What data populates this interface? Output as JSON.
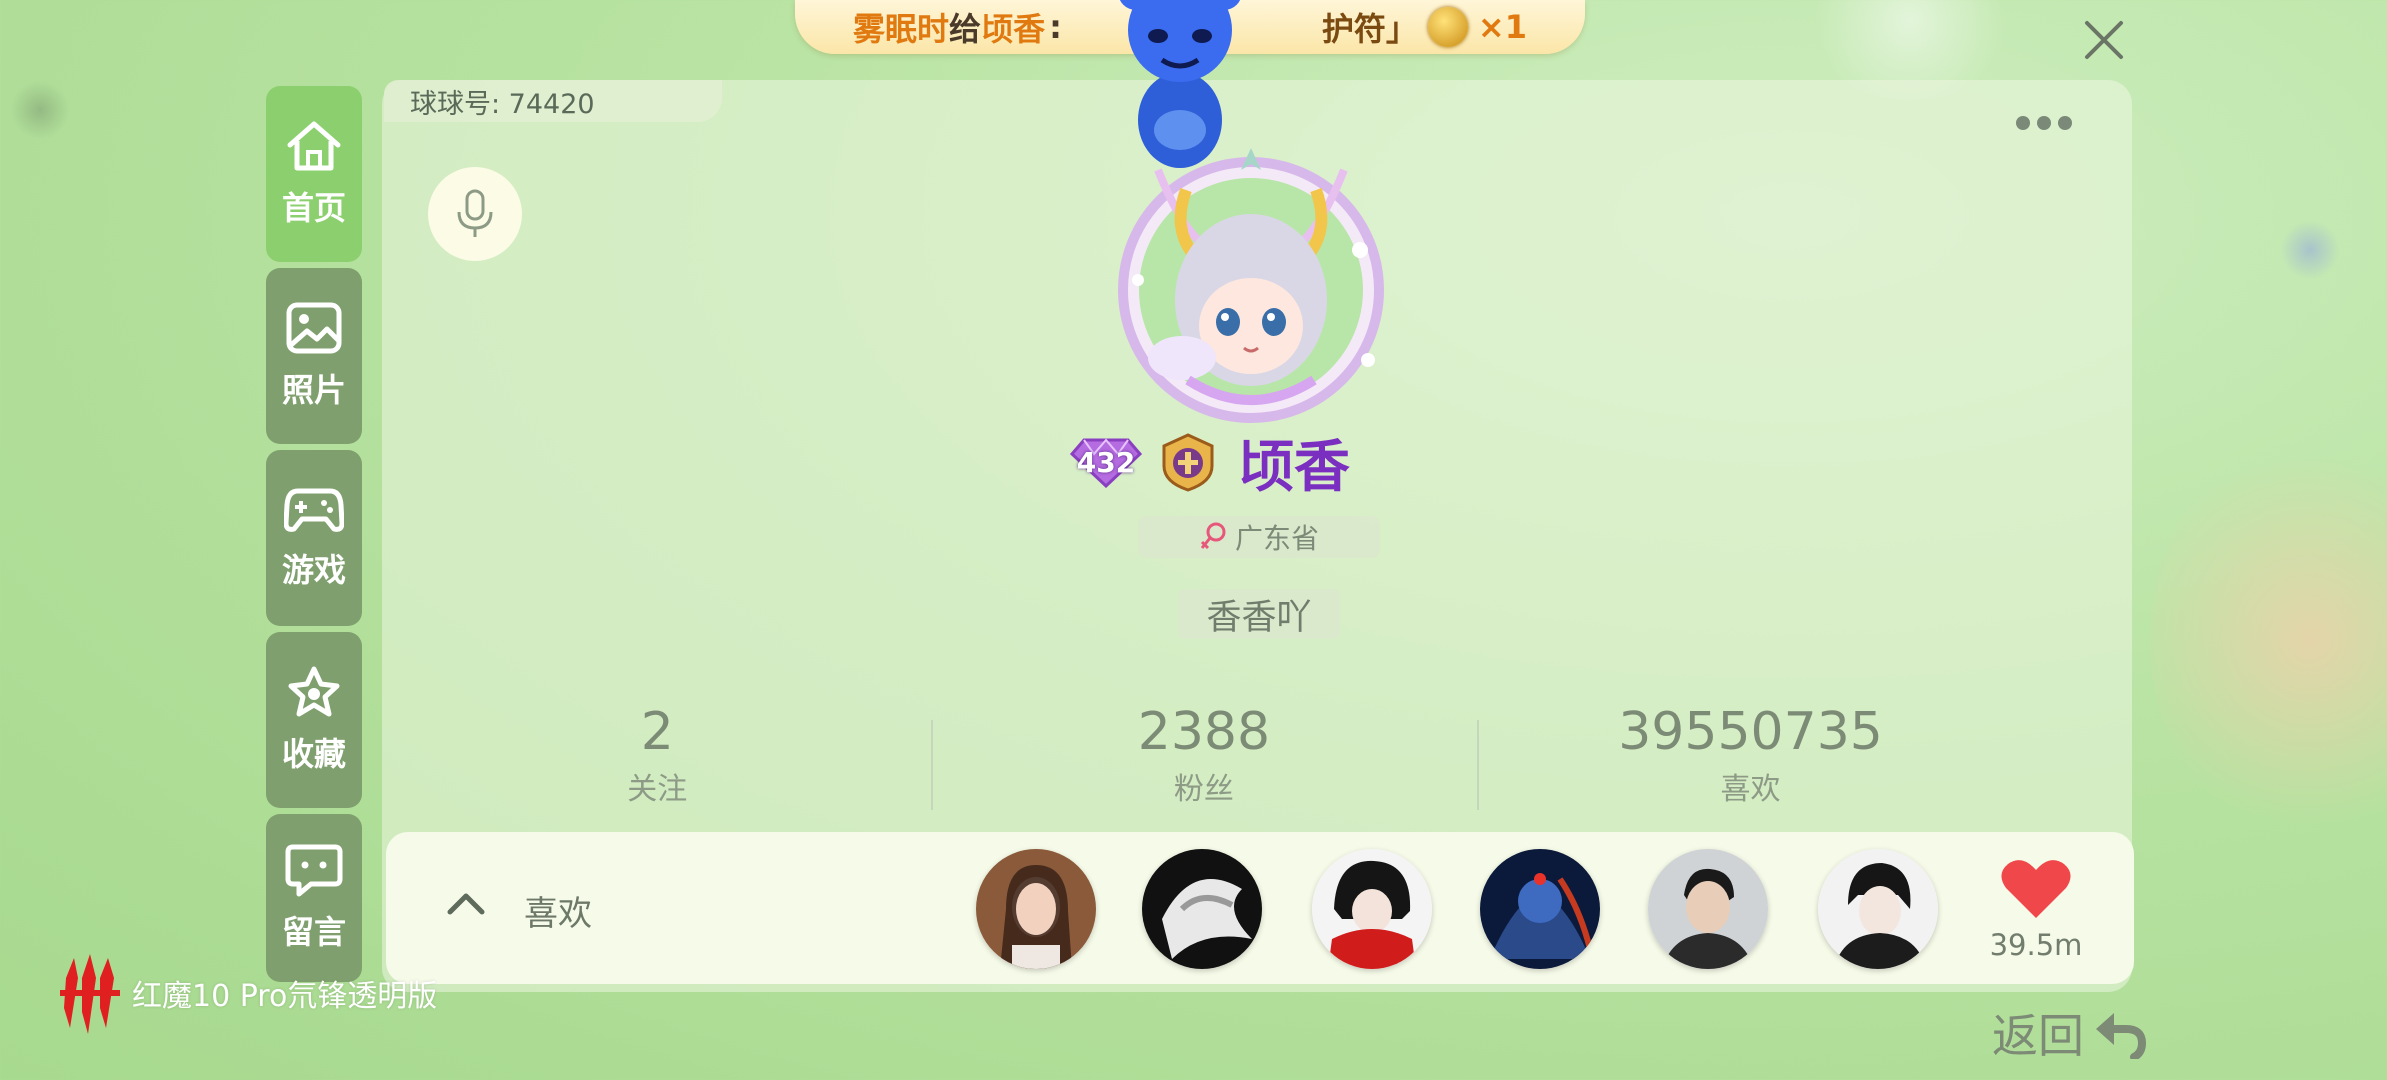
{
  "banner": {
    "sender": "雾眠时",
    "verb": "给",
    "receiver": "顷香",
    "colon": ":",
    "item_suffix": "护符」",
    "count": "×1"
  },
  "profile": {
    "ball_id": "球球号: 74420",
    "level": "432",
    "nickname": "顷香",
    "location": "广东省",
    "bio": "香香吖"
  },
  "sidebar": {
    "items": [
      {
        "label": "首页",
        "icon": "home-icon"
      },
      {
        "label": "照片",
        "icon": "photo-icon"
      },
      {
        "label": "游戏",
        "icon": "gamepad-icon"
      },
      {
        "label": "收藏",
        "icon": "star-icon"
      },
      {
        "label": "留言",
        "icon": "message-icon"
      }
    ]
  },
  "stats": [
    {
      "value": "2",
      "label": "关注"
    },
    {
      "value": "2388",
      "label": "粉丝"
    },
    {
      "value": "39550735",
      "label": "喜欢"
    }
  ],
  "likes": {
    "label": "喜欢",
    "total": "39.5m"
  },
  "back": {
    "label": "返回"
  },
  "watermark": {
    "text": "红魔10 Pro氘锋透明版"
  },
  "colors": {
    "accent_green": "#8ccf6e",
    "nav_green": "#7fa06e",
    "nickname_purple": "#7a2fc0",
    "heart_red": "#f0474a"
  }
}
